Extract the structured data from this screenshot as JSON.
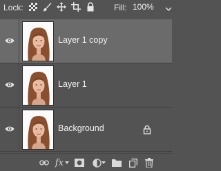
{
  "topbar": {
    "lock_label": "Lock:",
    "fill_label": "Fill:",
    "fill_value": "100%",
    "lock_icons": [
      "checkerboard-lock-icon",
      "brush-lock-icon",
      "move-lock-icon",
      "artboard-lock-icon",
      "padlock-icon"
    ]
  },
  "layers": [
    {
      "name": "Layer 1 copy",
      "visible": true,
      "selected": true,
      "locked": false
    },
    {
      "name": "Layer 1",
      "visible": true,
      "selected": false,
      "locked": false
    },
    {
      "name": "Background",
      "visible": true,
      "selected": false,
      "locked": true
    }
  ],
  "bottombar": {
    "fx_label": "fx",
    "icons": [
      "link-icon",
      "fx-icon",
      "mask-icon",
      "adjustment-icon",
      "folder-icon",
      "new-layer-icon",
      "trash-icon"
    ]
  },
  "colors": {
    "panel_bg": "#535353",
    "selected_row": "#6b6b6b",
    "text": "#e6e6e6"
  }
}
